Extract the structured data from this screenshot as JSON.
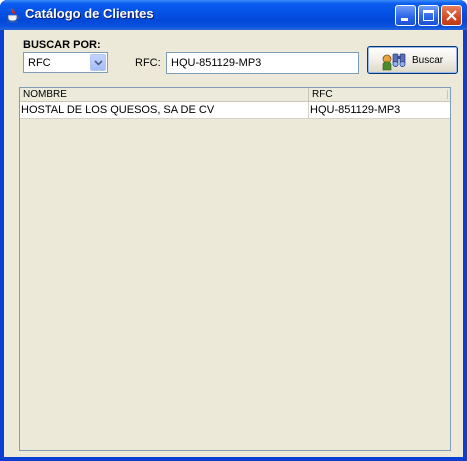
{
  "window": {
    "title": "Catálogo de Clientes",
    "app_icon": "java-cup-icon",
    "controls": [
      "minimize-icon",
      "maximize-icon",
      "close-icon"
    ]
  },
  "search": {
    "label": "BUSCAR POR:",
    "by_selected": "RFC",
    "rfc_label": "RFC:",
    "rfc_value": "HQU-851129-MP3",
    "button_label": "Buscar",
    "button_icon": "binoculars-icon"
  },
  "table": {
    "columns": [
      "NOMBRE",
      "RFC"
    ],
    "rows": [
      [
        "HOSTAL DE LOS QUESOS, SA DE CV",
        "HQU-851129-MP3"
      ]
    ]
  },
  "colors": {
    "titlebar": "#0551e6",
    "window_body": "#ece9d8",
    "close_button": "#d24a23"
  }
}
